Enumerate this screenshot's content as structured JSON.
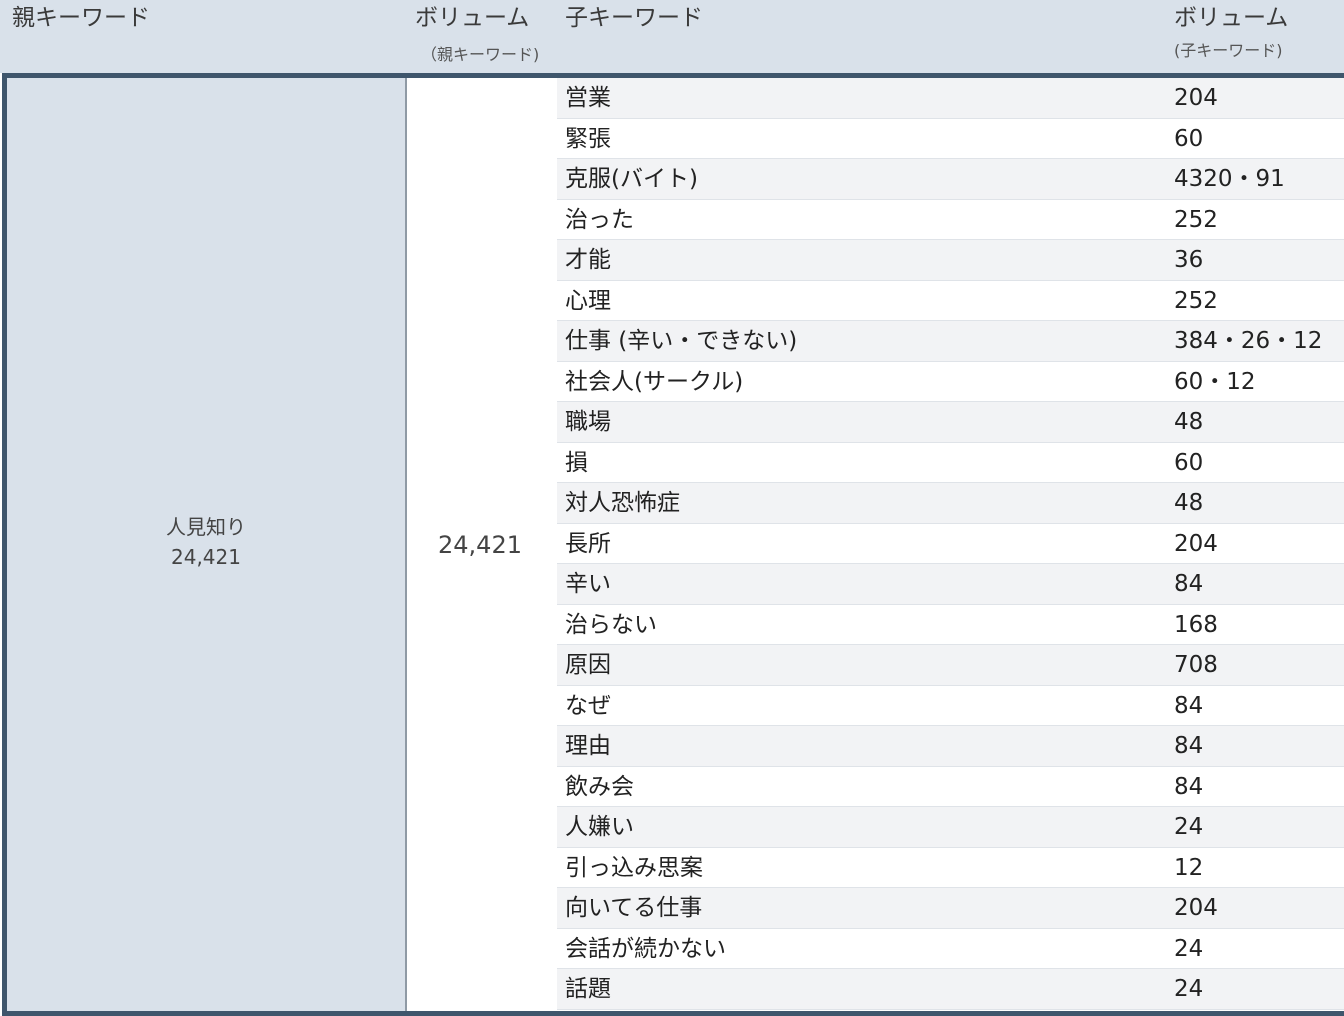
{
  "header": {
    "parent_keyword": "親キーワード",
    "volume_parent": "ボリューム",
    "volume_parent_sub": "（親キーワード)",
    "child_keyword": "子キーワード",
    "volume_child": "ボリューム",
    "volume_child_sub": "(子キーワード)"
  },
  "parent": {
    "keyword": "人見知り",
    "volume_small": "24,421",
    "volume": "24,421"
  },
  "rows": [
    {
      "keyword": "営業",
      "volume": "204"
    },
    {
      "keyword": "緊張",
      "volume": "60"
    },
    {
      "keyword": "克服(バイト)",
      "volume": "4320・91"
    },
    {
      "keyword": "治った",
      "volume": "252"
    },
    {
      "keyword": "才能",
      "volume": "36"
    },
    {
      "keyword": "心理",
      "volume": "252"
    },
    {
      "keyword": "仕事 (辛い・できない)",
      "volume": "384・26・12"
    },
    {
      "keyword": "社会人(サークル)",
      "volume": "60・12"
    },
    {
      "keyword": "職場",
      "volume": "48"
    },
    {
      "keyword": "損",
      "volume": "60"
    },
    {
      "keyword": "対人恐怖症",
      "volume": "48"
    },
    {
      "keyword": "長所",
      "volume": "204"
    },
    {
      "keyword": "辛い",
      "volume": "84"
    },
    {
      "keyword": "治らない",
      "volume": "168"
    },
    {
      "keyword": "原因",
      "volume": "708"
    },
    {
      "keyword": "なぜ",
      "volume": "84"
    },
    {
      "keyword": "理由",
      "volume": "84"
    },
    {
      "keyword": "飲み会",
      "volume": "84"
    },
    {
      "keyword": "人嫌い",
      "volume": "24"
    },
    {
      "keyword": "引っ込み思案",
      "volume": "12"
    },
    {
      "keyword": "向いてる仕事",
      "volume": "204"
    },
    {
      "keyword": "会話が続かない",
      "volume": "24"
    },
    {
      "keyword": "話題",
      "volume": "24"
    }
  ]
}
